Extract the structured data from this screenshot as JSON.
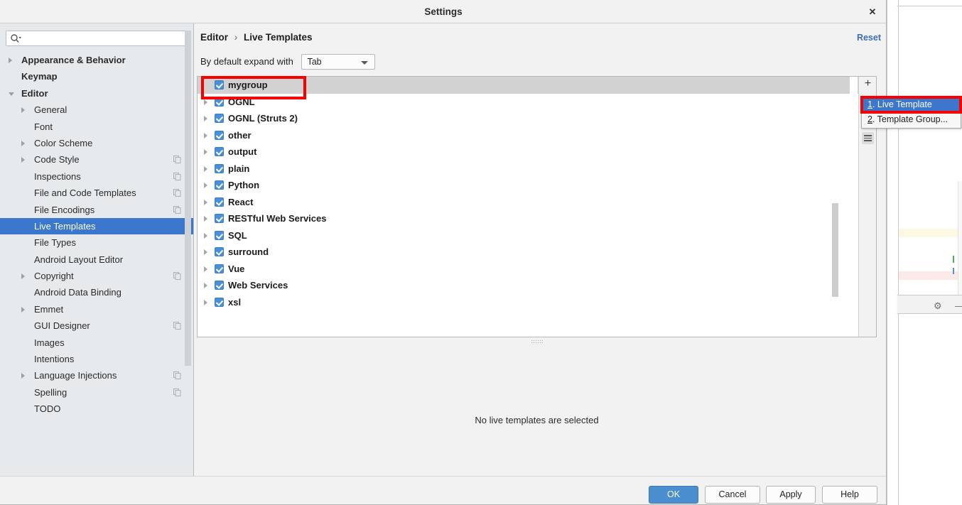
{
  "background_ide": {
    "gear_icon": "gear-icon",
    "minimize_icon": "minimize-icon"
  },
  "dialog": {
    "title": "Settings",
    "close_icon": "close-icon"
  },
  "sidebar": {
    "search": {
      "placeholder": "",
      "value": "",
      "icon": "search-icon"
    },
    "items": [
      {
        "label": "Appearance & Behavior",
        "indent": 30,
        "arrow": "right",
        "bold": true,
        "copy": false,
        "selected": false
      },
      {
        "label": "Keymap",
        "indent": 30,
        "arrow": "none",
        "bold": true,
        "copy": false,
        "selected": false
      },
      {
        "label": "Editor",
        "indent": 30,
        "arrow": "down",
        "bold": true,
        "copy": false,
        "selected": false
      },
      {
        "label": "General",
        "indent": 48,
        "arrow": "right",
        "bold": false,
        "copy": false,
        "selected": false
      },
      {
        "label": "Font",
        "indent": 48,
        "arrow": "none",
        "bold": false,
        "copy": false,
        "selected": false
      },
      {
        "label": "Color Scheme",
        "indent": 48,
        "arrow": "right",
        "bold": false,
        "copy": false,
        "selected": false
      },
      {
        "label": "Code Style",
        "indent": 48,
        "arrow": "right",
        "bold": false,
        "copy": true,
        "selected": false
      },
      {
        "label": "Inspections",
        "indent": 48,
        "arrow": "none",
        "bold": false,
        "copy": true,
        "selected": false
      },
      {
        "label": "File and Code Templates",
        "indent": 48,
        "arrow": "none",
        "bold": false,
        "copy": true,
        "selected": false
      },
      {
        "label": "File Encodings",
        "indent": 48,
        "arrow": "none",
        "bold": false,
        "copy": true,
        "selected": false
      },
      {
        "label": "Live Templates",
        "indent": 48,
        "arrow": "none",
        "bold": false,
        "copy": false,
        "selected": true
      },
      {
        "label": "File Types",
        "indent": 48,
        "arrow": "none",
        "bold": false,
        "copy": false,
        "selected": false
      },
      {
        "label": "Android Layout Editor",
        "indent": 48,
        "arrow": "none",
        "bold": false,
        "copy": false,
        "selected": false
      },
      {
        "label": "Copyright",
        "indent": 48,
        "arrow": "right",
        "bold": false,
        "copy": true,
        "selected": false
      },
      {
        "label": "Android Data Binding",
        "indent": 48,
        "arrow": "none",
        "bold": false,
        "copy": false,
        "selected": false
      },
      {
        "label": "Emmet",
        "indent": 48,
        "arrow": "right",
        "bold": false,
        "copy": false,
        "selected": false
      },
      {
        "label": "GUI Designer",
        "indent": 48,
        "arrow": "none",
        "bold": false,
        "copy": true,
        "selected": false
      },
      {
        "label": "Images",
        "indent": 48,
        "arrow": "none",
        "bold": false,
        "copy": false,
        "selected": false
      },
      {
        "label": "Intentions",
        "indent": 48,
        "arrow": "none",
        "bold": false,
        "copy": false,
        "selected": false
      },
      {
        "label": "Language Injections",
        "indent": 48,
        "arrow": "right",
        "bold": false,
        "copy": true,
        "selected": false
      },
      {
        "label": "Spelling",
        "indent": 48,
        "arrow": "none",
        "bold": false,
        "copy": true,
        "selected": false
      },
      {
        "label": "TODO",
        "indent": 48,
        "arrow": "none",
        "bold": false,
        "copy": false,
        "selected": false
      }
    ]
  },
  "content": {
    "breadcrumb": {
      "root": "Editor",
      "separator": "›",
      "leaf": "Live Templates"
    },
    "reset_label": "Reset",
    "expand_label": "By default expand with",
    "expand_value": "Tab",
    "empty_message": "No live templates are selected",
    "toolbar": {
      "add_label": "+",
      "list_icon": "list-icon"
    },
    "groups": [
      {
        "label": "mygroup",
        "checked": true,
        "expandable": false,
        "selected": true
      },
      {
        "label": "OGNL",
        "checked": true,
        "expandable": true,
        "selected": false
      },
      {
        "label": "OGNL (Struts 2)",
        "checked": true,
        "expandable": true,
        "selected": false
      },
      {
        "label": "other",
        "checked": true,
        "expandable": true,
        "selected": false
      },
      {
        "label": "output",
        "checked": true,
        "expandable": true,
        "selected": false
      },
      {
        "label": "plain",
        "checked": true,
        "expandable": true,
        "selected": false
      },
      {
        "label": "Python",
        "checked": true,
        "expandable": true,
        "selected": false
      },
      {
        "label": "React",
        "checked": true,
        "expandable": true,
        "selected": false
      },
      {
        "label": "RESTful Web Services",
        "checked": true,
        "expandable": true,
        "selected": false
      },
      {
        "label": "SQL",
        "checked": true,
        "expandable": true,
        "selected": false
      },
      {
        "label": "surround",
        "checked": true,
        "expandable": true,
        "selected": false
      },
      {
        "label": "Vue",
        "checked": true,
        "expandable": true,
        "selected": false
      },
      {
        "label": "Web Services",
        "checked": true,
        "expandable": true,
        "selected": false
      },
      {
        "label": "xsl",
        "checked": true,
        "expandable": true,
        "selected": false
      }
    ]
  },
  "add_menu": {
    "items": [
      {
        "mnemonic": "1",
        "label": ". Live Template",
        "highlight": true
      },
      {
        "mnemonic": "2",
        "label": ". Template Group...",
        "highlight": false
      }
    ]
  },
  "footer": {
    "ok": "OK",
    "cancel": "Cancel",
    "apply": "Apply",
    "help": "Help"
  },
  "colors": {
    "selection_blue": "#3b78cd",
    "checkbox_blue": "#4a90d9",
    "annotation_red": "#f90000",
    "sidebar_bg": "#e6eaed",
    "dialog_bg": "#f2f2f2",
    "link_blue": "#3b6eb4"
  }
}
